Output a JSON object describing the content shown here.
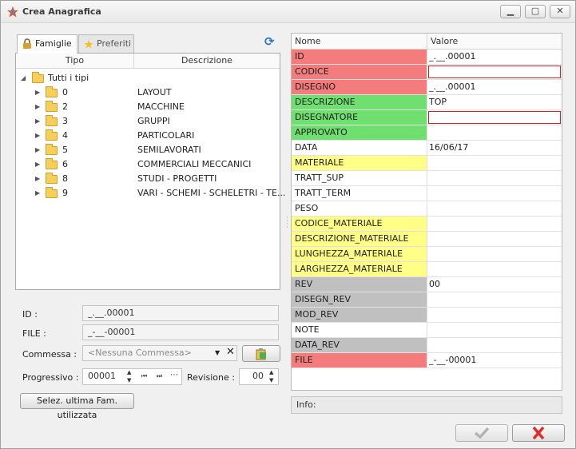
{
  "window": {
    "title": "Crea Anagrafica",
    "minimize": "▁",
    "maximize": "▢",
    "close": "✕"
  },
  "tabs": [
    {
      "label": "Famiglie"
    },
    {
      "label": "Preferiti"
    }
  ],
  "tree": {
    "columns": {
      "tipo": "Tipo",
      "descrizione": "Descrizione"
    },
    "root_label": "Tutti i tipi",
    "rows": [
      {
        "code": "0",
        "desc": "LAYOUT"
      },
      {
        "code": "2",
        "desc": "MACCHINE"
      },
      {
        "code": "3",
        "desc": "GRUPPI"
      },
      {
        "code": "4",
        "desc": "PARTICOLARI"
      },
      {
        "code": "5",
        "desc": "SEMILAVORATI"
      },
      {
        "code": "6",
        "desc": "COMMERCIALI MECCANICI"
      },
      {
        "code": "8",
        "desc": "STUDI - PROGETTI"
      },
      {
        "code": "9",
        "desc": "VARI - SCHEMI - SCHELETRI - TE..."
      }
    ]
  },
  "form": {
    "id_label": "ID :",
    "id_value": "_.__.00001",
    "file_label": "FILE :",
    "file_value": "_-__-00001",
    "commessa_label": "Commessa :",
    "commessa_placeholder": "<Nessuna Commessa>",
    "progressivo_label": "Progressivo :",
    "progressivo_value": "00001",
    "revisione_label": "Revisione :",
    "revisione_value": "00",
    "last_family_button": "Selez. ultima Fam. utilizzata"
  },
  "grid": {
    "columns": {
      "name": "Nome",
      "value": "Valore"
    },
    "colors": {
      "red": "#f47c7c",
      "green": "#6fe06f",
      "yellow": "#ffff88",
      "gray": "#c0c0c0",
      "white": "#ffffff"
    },
    "rows": [
      {
        "name": "ID",
        "value": "_.__.00001",
        "color": "red"
      },
      {
        "name": "CODICE",
        "value": "",
        "color": "red",
        "required": true
      },
      {
        "name": "DISEGNO",
        "value": "_.__.00001",
        "color": "red"
      },
      {
        "name": "DESCRIZIONE",
        "value": "TOP",
        "color": "green"
      },
      {
        "name": "DISEGNATORE",
        "value": "",
        "color": "green",
        "required": true
      },
      {
        "name": "APPROVATO",
        "value": "",
        "color": "green"
      },
      {
        "name": "DATA",
        "value": "16/06/17",
        "color": "white"
      },
      {
        "name": "MATERIALE",
        "value": "",
        "color": "yellow"
      },
      {
        "name": "TRATT_SUP",
        "value": "",
        "color": "white"
      },
      {
        "name": "TRATT_TERM",
        "value": "",
        "color": "white"
      },
      {
        "name": "PESO",
        "value": "",
        "color": "white"
      },
      {
        "name": "CODICE_MATERIALE",
        "value": "",
        "color": "yellow"
      },
      {
        "name": "DESCRIZIONE_MATERIALE",
        "value": "",
        "color": "yellow"
      },
      {
        "name": "LUNGHEZZA_MATERIALE",
        "value": "",
        "color": "yellow"
      },
      {
        "name": "LARGHEZZA_MATERIALE",
        "value": "",
        "color": "yellow"
      },
      {
        "name": "REV",
        "value": "00",
        "color": "gray"
      },
      {
        "name": "DISEGN_REV",
        "value": "",
        "color": "gray"
      },
      {
        "name": "MOD_REV",
        "value": "",
        "color": "gray"
      },
      {
        "name": "NOTE",
        "value": "",
        "color": "white"
      },
      {
        "name": "DATA_REV",
        "value": "",
        "color": "gray"
      },
      {
        "name": "FILE",
        "value": "_-__-00001",
        "color": "red"
      }
    ]
  },
  "info_label": "Info:",
  "footer": {
    "ok_icon": "checkmark-icon",
    "cancel_icon": "cross-icon"
  }
}
